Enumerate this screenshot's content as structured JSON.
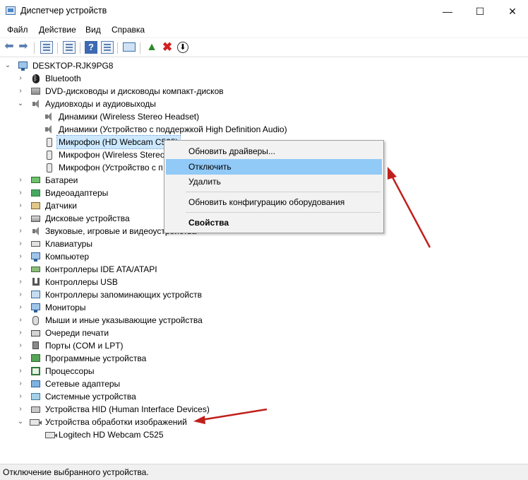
{
  "window": {
    "title": "Диспетчер устройств",
    "minimize": "—",
    "maximize": "☐",
    "close": "✕"
  },
  "menu": [
    "Файл",
    "Действие",
    "Вид",
    "Справка"
  ],
  "toolbar_icons": [
    "back-arrow-icon",
    "forward-arrow-icon",
    "properties-icon",
    "list-icon",
    "help-icon",
    "view-icon",
    "monitor-icon",
    "update-driver-icon",
    "uninstall-icon",
    "scan-hardware-icon"
  ],
  "tree": {
    "root": "DESKTOP-RJK9PG8",
    "items": [
      "Bluetooth",
      "DVD-дисководы и дисководы компакт-дисков",
      "Аудиовходы и аудиовыходы",
      "Динамики (Wireless Stereo Headset)",
      "Динамики (Устройство с поддержкой High Definition Audio)",
      "Микрофон (HD Webcam C525)",
      "Микрофон (Wireless Stereo",
      "Микрофон (Устройство с п",
      "Батареи",
      "Видеоадаптеры",
      "Датчики",
      "Дисковые устройства",
      "Звуковые, игровые и видеоустройства",
      "Клавиатуры",
      "Компьютер",
      "Контроллеры IDE ATA/ATAPI",
      "Контроллеры USB",
      "Контроллеры запоминающих устройств",
      "Мониторы",
      "Мыши и иные указывающие устройства",
      "Очереди печати",
      "Порты (COM и LPT)",
      "Программные устройства",
      "Процессоры",
      "Сетевые адаптеры",
      "Системные устройства",
      "Устройства HID (Human Interface Devices)",
      "Устройства обработки изображений",
      "Logitech HD Webcam C525"
    ]
  },
  "context_menu": {
    "update": "Обновить драйверы...",
    "disable": "Отключить",
    "uninstall": "Удалить",
    "scan": "Обновить конфигурацию оборудования",
    "properties": "Свойства"
  },
  "status_text": "Отключение выбранного устройства.",
  "colors": {
    "menu_hover": "#91c9f7",
    "selection": "#cce8ff",
    "annotation_arrow": "#c0201c"
  }
}
